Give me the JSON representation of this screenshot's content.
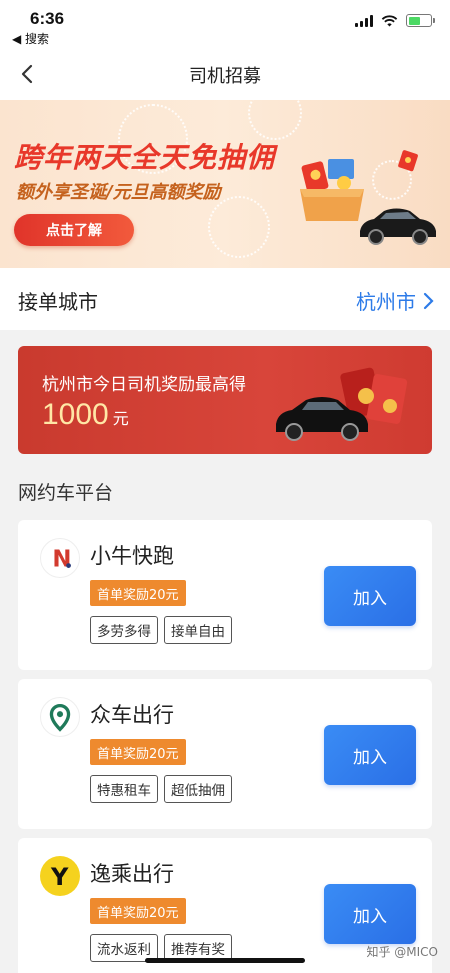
{
  "status_bar": {
    "time": "6:36",
    "back_app": "◀ 搜索",
    "battery_level": 0.55
  },
  "nav": {
    "title": "司机招募"
  },
  "hero": {
    "title": "跨年两天全天免抽佣",
    "subtitle": "额外享圣诞/元旦高额奖励",
    "cta": "点击了解"
  },
  "city": {
    "label": "接单城市",
    "value": "杭州市"
  },
  "reward": {
    "text": "杭州市今日司机奖励最高得",
    "amount": "1000",
    "unit": "元"
  },
  "section_title": "网约车平台",
  "platforms": [
    {
      "name": "小牛快跑",
      "bonus": "首单奖励20元",
      "tags": [
        "多劳多得",
        "接单自由"
      ],
      "join": "加入",
      "logo_letter": "N"
    },
    {
      "name": "众车出行",
      "bonus": "首单奖励20元",
      "tags": [
        "特惠租车",
        "超低抽佣"
      ],
      "join": "加入"
    },
    {
      "name": "逸乘出行",
      "bonus": "首单奖励20元",
      "tags": [
        "流水返利",
        "推荐有奖"
      ],
      "join": "加入",
      "logo_letter": "Y"
    }
  ],
  "watermark": "知乎 @MICO",
  "colors": {
    "accent_blue": "#2d7be8",
    "bonus_orange": "#ee8a2e",
    "banner_red": "#c93a2e"
  }
}
